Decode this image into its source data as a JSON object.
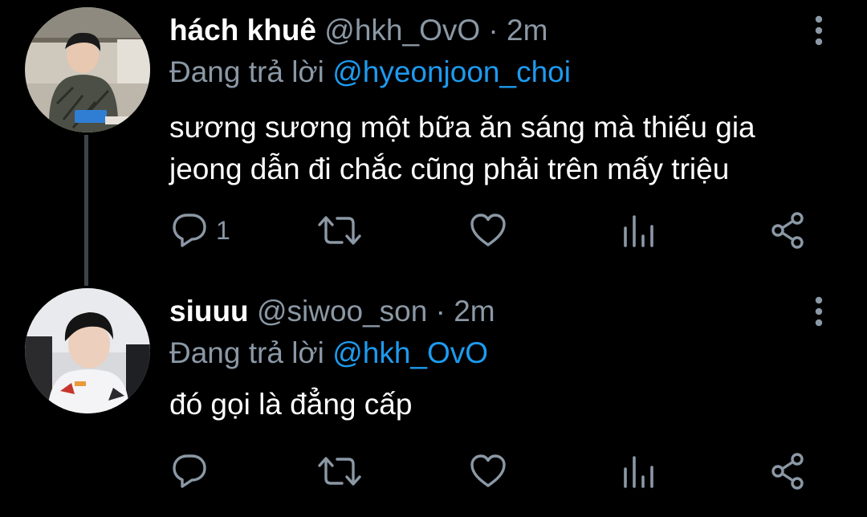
{
  "colors": {
    "background": "#000000",
    "text": "#ffffff",
    "muted": "#8b98a5",
    "link": "#1d9bf0",
    "thread_line": "#3d4349"
  },
  "tweets": [
    {
      "display_name": "hách khuê",
      "handle": "@hkh_OvO",
      "separator": "·",
      "time": "2m",
      "reply_prefix": "Đang trả lời",
      "reply_target": "@hyeonjoon_choi",
      "text_lines": [
        "sương sương một bữa ăn sáng mà thiếu gia",
        "jeong dẫn đi chắc cũng phải trên mấy triệu"
      ],
      "reply_count": "1",
      "icons": [
        "reply-icon",
        "retweet-icon",
        "like-icon",
        "analytics-icon",
        "share-icon"
      ]
    },
    {
      "display_name": "siuuu",
      "handle": "@siwoo_son",
      "separator": "·",
      "time": "2m",
      "reply_prefix": "Đang trả lời",
      "reply_target": "@hkh_OvO",
      "text_lines": [
        "đó gọi là đẳng cấp"
      ],
      "reply_count": "",
      "icons": [
        "reply-icon",
        "retweet-icon",
        "like-icon",
        "analytics-icon",
        "share-icon"
      ]
    }
  ]
}
